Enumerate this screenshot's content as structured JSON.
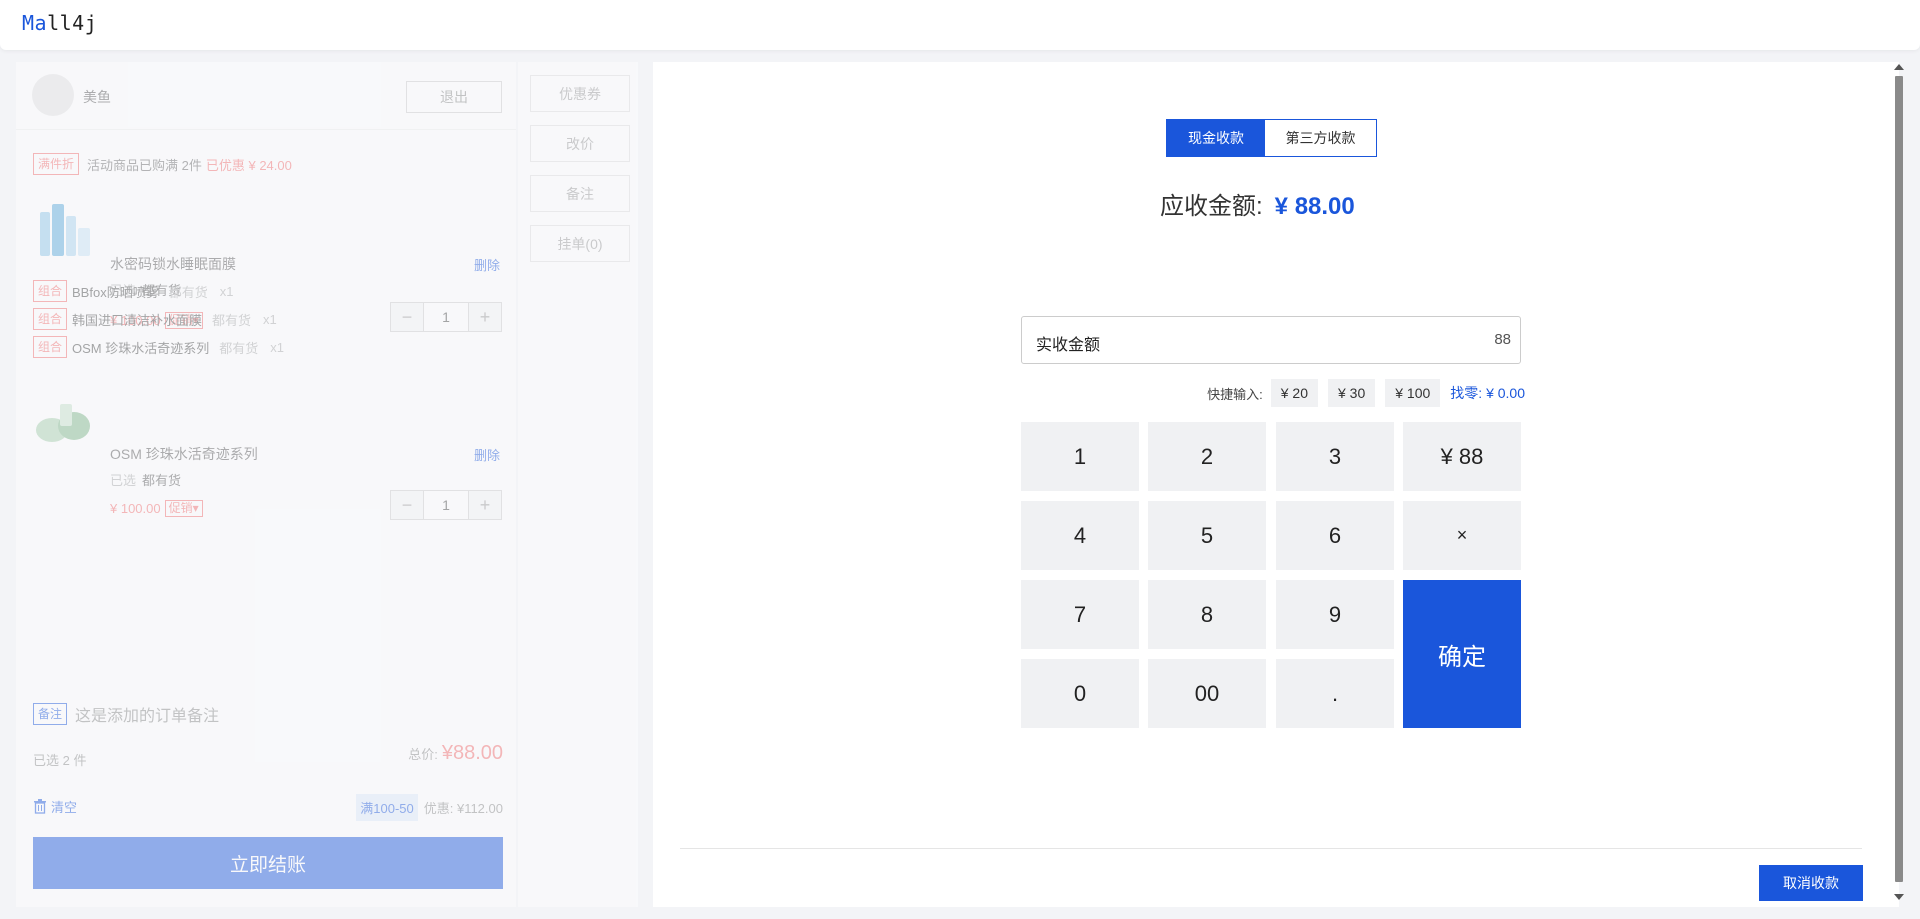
{
  "app": {
    "logo_a": "Ma",
    "logo_b": "ll4j"
  },
  "user": {
    "name": "美鱼",
    "logout_label": "退出"
  },
  "side_actions": [
    "优惠券",
    "改价",
    "备注",
    "挂单(0)"
  ],
  "promotion": {
    "tag": "满件折",
    "text": "活动商品已购满 2件",
    "discount": "已优惠 ¥ 24.00"
  },
  "items": [
    {
      "name": "水密码锁水睡眠面膜",
      "delete_label": "删除",
      "selected_label": "已选",
      "stock": "都有货",
      "price": "¥ 100.00",
      "promo_label": "促销",
      "quantity": "1",
      "combos": [
        {
          "tag": "组合",
          "name": "BBfox防晒喷雾",
          "stock": "都有货",
          "qty": "x1"
        },
        {
          "tag": "组合",
          "name": "韩国进口清洁补水面膜",
          "stock": "都有货",
          "qty": "x1"
        },
        {
          "tag": "组合",
          "name": "OSM 珍珠水活奇迹系列",
          "stock": "都有货",
          "qty": "x1"
        }
      ]
    },
    {
      "name": "OSM 珍珠水活奇迹系列",
      "delete_label": "删除",
      "selected_label": "已选",
      "stock": "都有货",
      "price": "¥ 100.00",
      "promo_label": "促销",
      "quantity": "1",
      "combos": []
    }
  ],
  "order_note": {
    "tag": "备注",
    "text": "这是添加的订单备注"
  },
  "summary": {
    "selected_count": "已选 2 件",
    "total_label": "总价:",
    "total_value": "¥88.00",
    "clear_label": "清空",
    "discount_tag": "满100-50",
    "discount_text": "优惠: ¥112.00",
    "checkout_label": "立即结账"
  },
  "payment": {
    "tabs": [
      {
        "label": "现金收款",
        "active": true
      },
      {
        "label": "第三方收款",
        "active": false
      }
    ],
    "due_label": "应收金额:",
    "due_amount": "¥ 88.00",
    "received_label": "实收金额",
    "received_value": "88",
    "quick_label": "快捷输入:",
    "quick_values": [
      "¥ 20",
      "¥ 30",
      "¥ 100"
    ],
    "change_text": "找零: ¥ 0.00",
    "keys": [
      "1",
      "2",
      "3",
      "¥ 88",
      "4",
      "5",
      "6",
      "×",
      "7",
      "8",
      "9",
      "0",
      "00",
      "."
    ],
    "confirm_label": "确定",
    "cancel_label": "取消收款"
  },
  "colors": {
    "accent": "#1a56db",
    "discount_red": "#f56c6c",
    "background": "#f3f4f7"
  },
  "icons": {
    "clear": "trash-icon",
    "avatar": "avatar"
  }
}
